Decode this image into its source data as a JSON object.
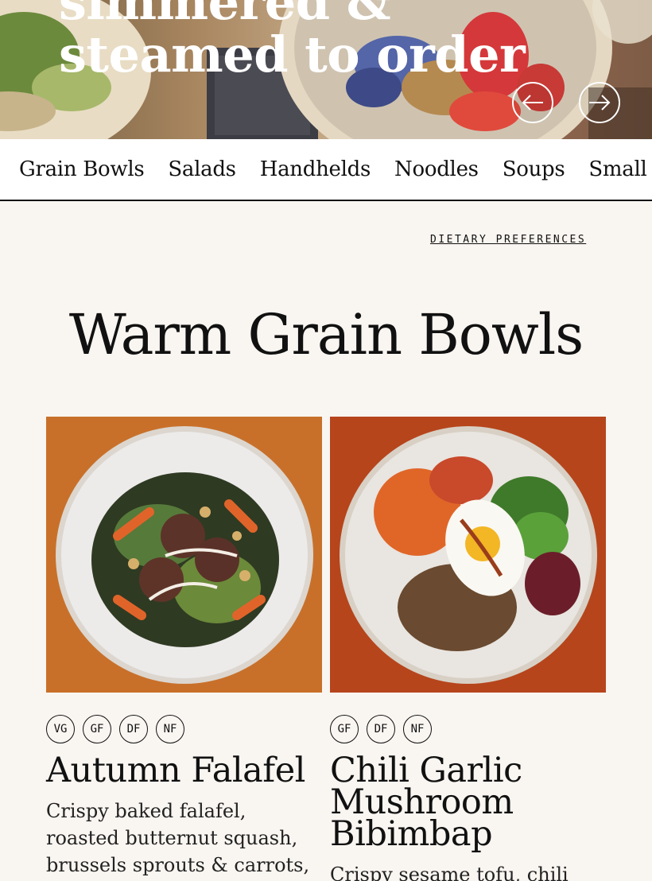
{
  "hero": {
    "title_line1": "simmered &",
    "title_line2": "steamed to order"
  },
  "nav": {
    "categories": [
      "Grain Bowls",
      "Salads",
      "Handhelds",
      "Noodles",
      "Soups",
      "Small Bite"
    ]
  },
  "dietary_link": "DIETARY PREFERENCES",
  "section_title": "Warm Grain Bowls",
  "products": [
    {
      "name": "Autumn Falafel",
      "tags": [
        "VG",
        "GF",
        "DF",
        "NF"
      ],
      "description": "Crispy baked falafel, roasted butternut squash, brussels sprouts & carrots, kale, crispy"
    },
    {
      "name": "Chili Garlic Mushroom Bibimbap",
      "tags": [
        "GF",
        "DF",
        "NF"
      ],
      "description": "Crispy sesame tofu, chili garlic"
    }
  ]
}
